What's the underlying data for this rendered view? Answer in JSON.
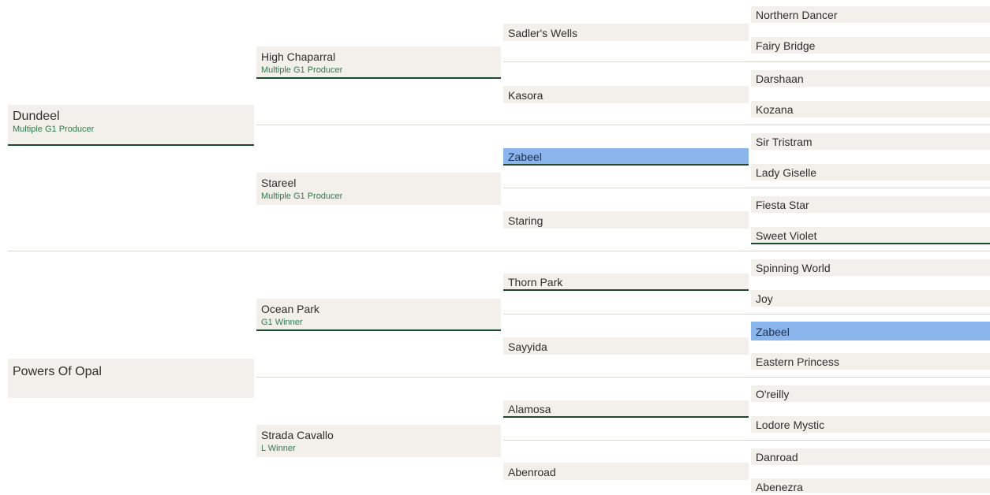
{
  "pedigree": {
    "sire": {
      "name": "Dundeel",
      "subtitle": "Multiple G1 Producer",
      "sire": {
        "name": "High Chaparral",
        "subtitle": "Multiple G1 Producer",
        "sire": {
          "name": "Sadler's Wells",
          "sire": "Northern Dancer",
          "dam": "Fairy Bridge"
        },
        "dam": {
          "name": "Kasora",
          "sire": "Darshaan",
          "dam": "Kozana"
        }
      },
      "dam": {
        "name": "Stareel",
        "subtitle": "Multiple G1 Producer",
        "sire": {
          "name": "Zabeel",
          "sire": "Sir Tristram",
          "dam": "Lady Giselle"
        },
        "dam": {
          "name": "Staring",
          "sire": "Fiesta Star",
          "dam": "Sweet Violet"
        }
      }
    },
    "dam": {
      "name": "Powers Of Opal",
      "sire": {
        "name": "Ocean Park",
        "subtitle": "G1 Winner",
        "sire": {
          "name": "Thorn Park",
          "sire": "Spinning World",
          "dam": "Joy"
        },
        "dam": {
          "name": "Sayyida",
          "sire": "Zabeel",
          "dam": "Eastern Princess"
        }
      },
      "dam": {
        "name": "Strada Cavallo",
        "subtitle": "L Winner",
        "sire": {
          "name": "Alamosa",
          "sire": "O'reilly",
          "dam": "Lodore Mystic"
        },
        "dam": {
          "name": "Abenroad",
          "sire": "Danroad",
          "dam": "Abenezra"
        }
      }
    }
  },
  "highlight": {
    "duplicate_ancestor": "Zabeel",
    "color": "#8ab4ec"
  },
  "colors": {
    "cell_bg": "#f3f0ec",
    "underline": "#1d4a2c",
    "subtitle": "#2f7a4a"
  }
}
